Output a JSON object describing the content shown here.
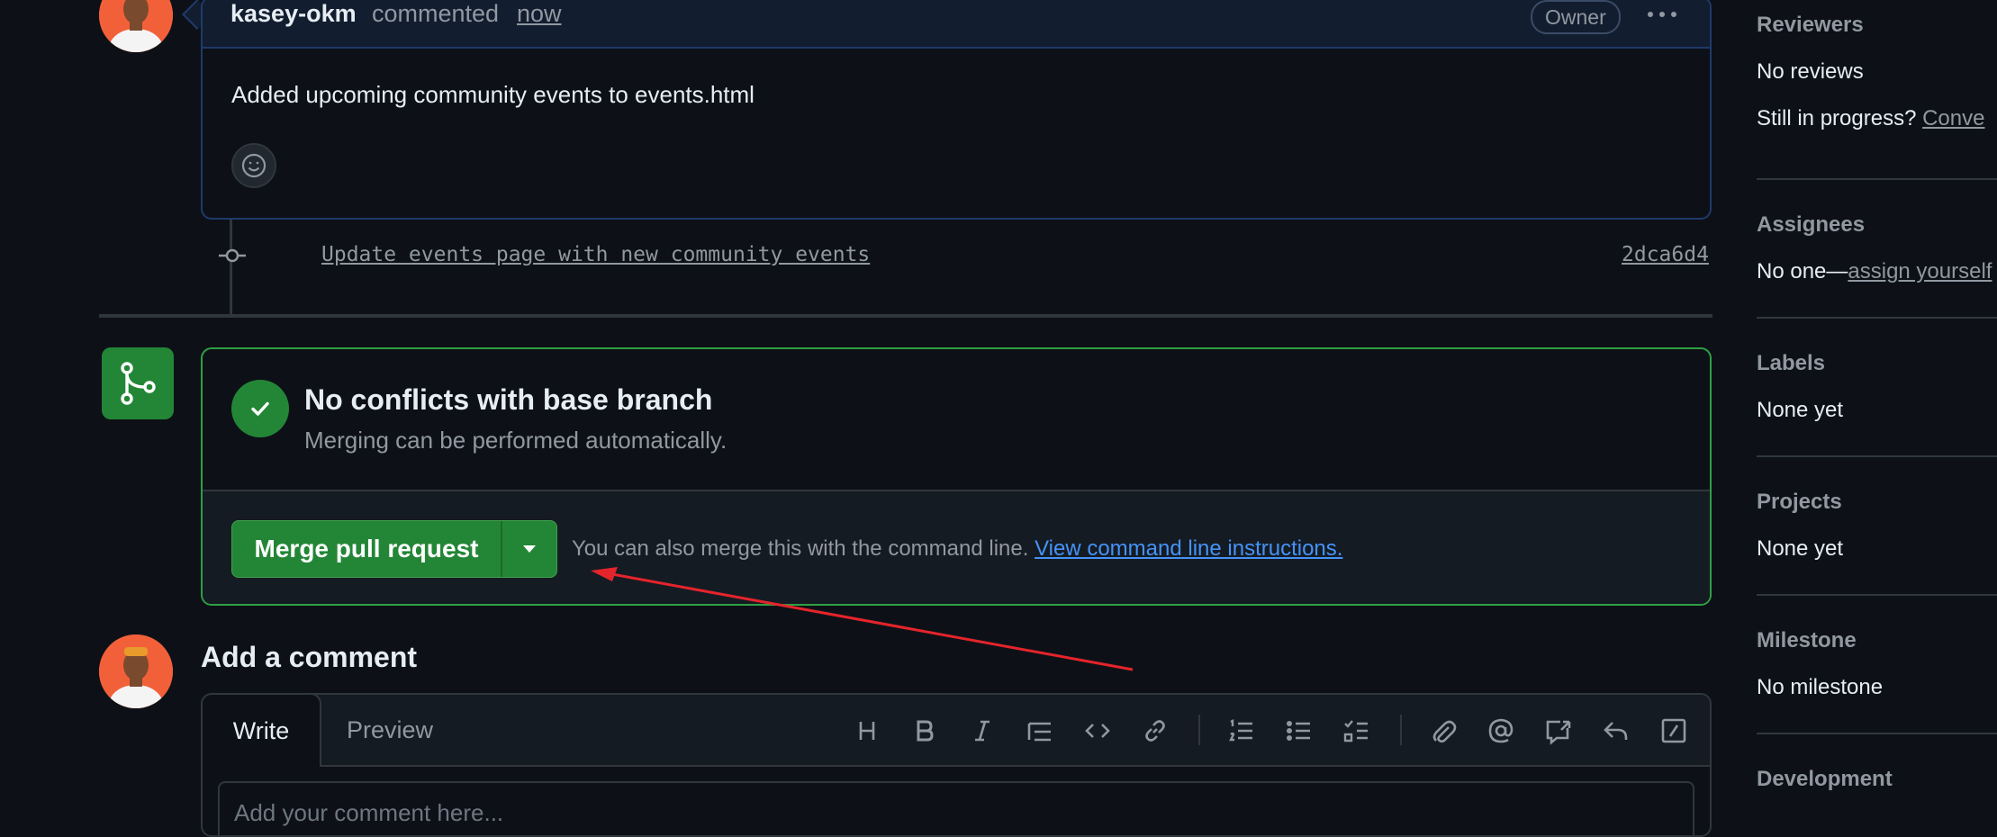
{
  "comment": {
    "author": "kasey-okm",
    "action": "commented",
    "time": "now",
    "role_badge": "Owner",
    "body": "Added upcoming community events to events.html"
  },
  "commit": {
    "message": "Update events page with new community events",
    "sha": "2dca6d4"
  },
  "merge": {
    "title": "No conflicts with base branch",
    "subtitle": "Merging can be performed automatically.",
    "button_label": "Merge pull request",
    "hint_text": "You can also merge this with the command line.",
    "hint_link": "View command line instructions.",
    "accent_color": "#238636"
  },
  "add_comment": {
    "title": "Add a comment",
    "tabs": [
      "Write",
      "Preview"
    ],
    "placeholder": "Add your comment here...",
    "toolbar_icons": [
      "heading-icon",
      "bold-icon",
      "italic-icon",
      "quote-icon",
      "code-icon",
      "link-icon",
      "numbered-list-icon",
      "bulleted-list-icon",
      "task-list-icon",
      "attach-icon",
      "mention-icon",
      "reference-icon",
      "saved-replies-icon",
      "slash-commands-icon"
    ]
  },
  "sidebar": {
    "reviewers": {
      "label": "Reviewers",
      "value": "No reviews",
      "progress_prefix": "Still in progress?",
      "progress_link": "Conve"
    },
    "assignees": {
      "label": "Assignees",
      "prefix": "No one—",
      "link": "assign yourself"
    },
    "labels": {
      "label": "Labels",
      "value": "None yet"
    },
    "projects": {
      "label": "Projects",
      "value": "None yet"
    },
    "milestone": {
      "label": "Milestone",
      "value": "No milestone"
    },
    "development": {
      "label": "Development"
    }
  }
}
